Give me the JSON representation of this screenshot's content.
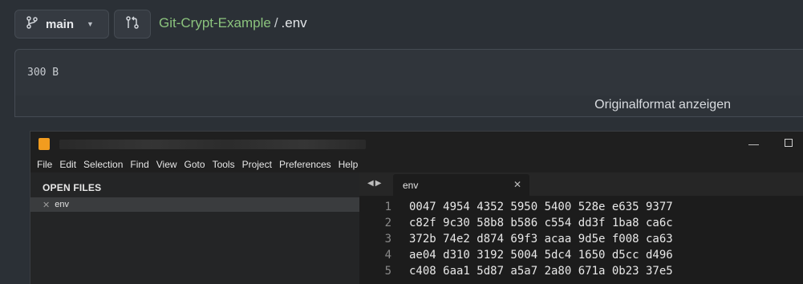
{
  "header": {
    "branch_label": "main",
    "repo_name": "Git-Crypt-Example",
    "separator": "/",
    "file_name": ".env"
  },
  "file": {
    "size": "300 B",
    "raw_link_label": "Originalformat anzeigen"
  },
  "sublime": {
    "menu": [
      "File",
      "Edit",
      "Selection",
      "Find",
      "View",
      "Goto",
      "Tools",
      "Project",
      "Preferences",
      "Help"
    ],
    "sidebar_title": "OPEN FILES",
    "open_file": "env",
    "tab_label": "env",
    "lines": [
      {
        "num": "1",
        "text": "0047 4954 4352 5950 5400 528e e635 9377"
      },
      {
        "num": "2",
        "text": "c82f 9c30 58b8 b586 c554 dd3f 1ba8 ca6c"
      },
      {
        "num": "3",
        "text": "372b 74e2 d874 69f3 acaa 9d5e f008 ca63"
      },
      {
        "num": "4",
        "text": "ae04 d310 3192 5004 5dc4 1650 d5cc d496"
      },
      {
        "num": "5",
        "text": "c408 6aa1 5d87 a5a7 2a80 671a 0b23 37e5"
      }
    ]
  },
  "colors": {
    "page_bg": "#2b3036",
    "repo_link": "#8bc37d",
    "sublime_icon": "#f29c1f"
  }
}
